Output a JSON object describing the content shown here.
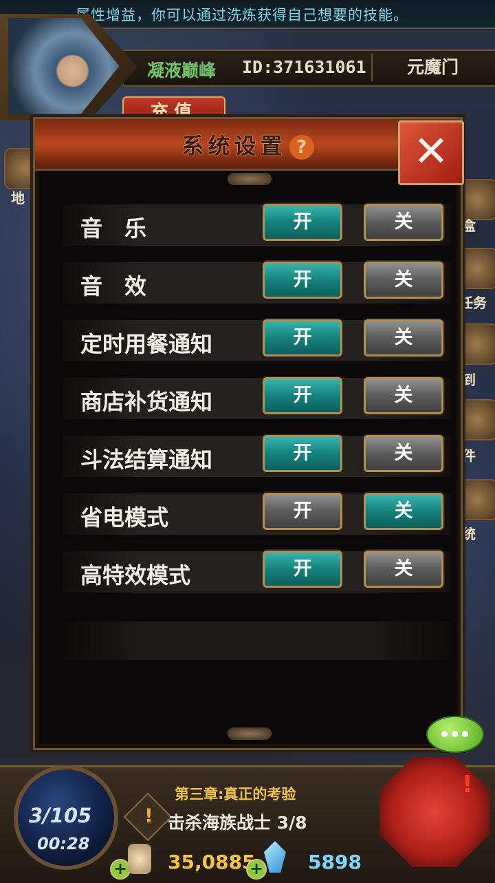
{
  "ticker": {
    "text": "属性增益，你可以通过洗炼获得自己想要的技能。"
  },
  "player": {
    "name": "凝液巅峰",
    "id": "ID:371631061",
    "sect": "元魔门"
  },
  "recharge_label": "充值",
  "side_labels": {
    "left_map": "地",
    "right_1": "盒",
    "right_2": "任务",
    "right_3": "到",
    "right_4": "件",
    "right_5": "统"
  },
  "dialog": {
    "title": "系统设置",
    "help_glyph": "?",
    "close_glyph": "✕",
    "rows": [
      {
        "label": "音　乐",
        "on_label": "开",
        "off_label": "关",
        "state": "on"
      },
      {
        "label": "音　效",
        "on_label": "开",
        "off_label": "关",
        "state": "on"
      },
      {
        "label": "定时用餐通知",
        "on_label": "开",
        "off_label": "关",
        "state": "on"
      },
      {
        "label": "商店补货通知",
        "on_label": "开",
        "off_label": "关",
        "state": "on"
      },
      {
        "label": "斗法结算通知",
        "on_label": "开",
        "off_label": "关",
        "state": "on"
      },
      {
        "label": "省电模式",
        "on_label": "开",
        "off_label": "关",
        "state": "off"
      },
      {
        "label": "高特效模式",
        "on_label": "开",
        "off_label": "关",
        "state": "on"
      }
    ]
  },
  "hud": {
    "wave": "3/105",
    "timer": "00:28",
    "chapter": "第三章:真正的考验",
    "quest_icon": "!",
    "quest": "击杀海族战士 3/8",
    "gold": "35,0885",
    "gems": "5898",
    "plus_glyph": "+",
    "skill_alert": "!"
  },
  "colors": {
    "active_button": "#16827d",
    "inactive_button": "#5c5c5c",
    "accent_red": "#b8481e"
  }
}
